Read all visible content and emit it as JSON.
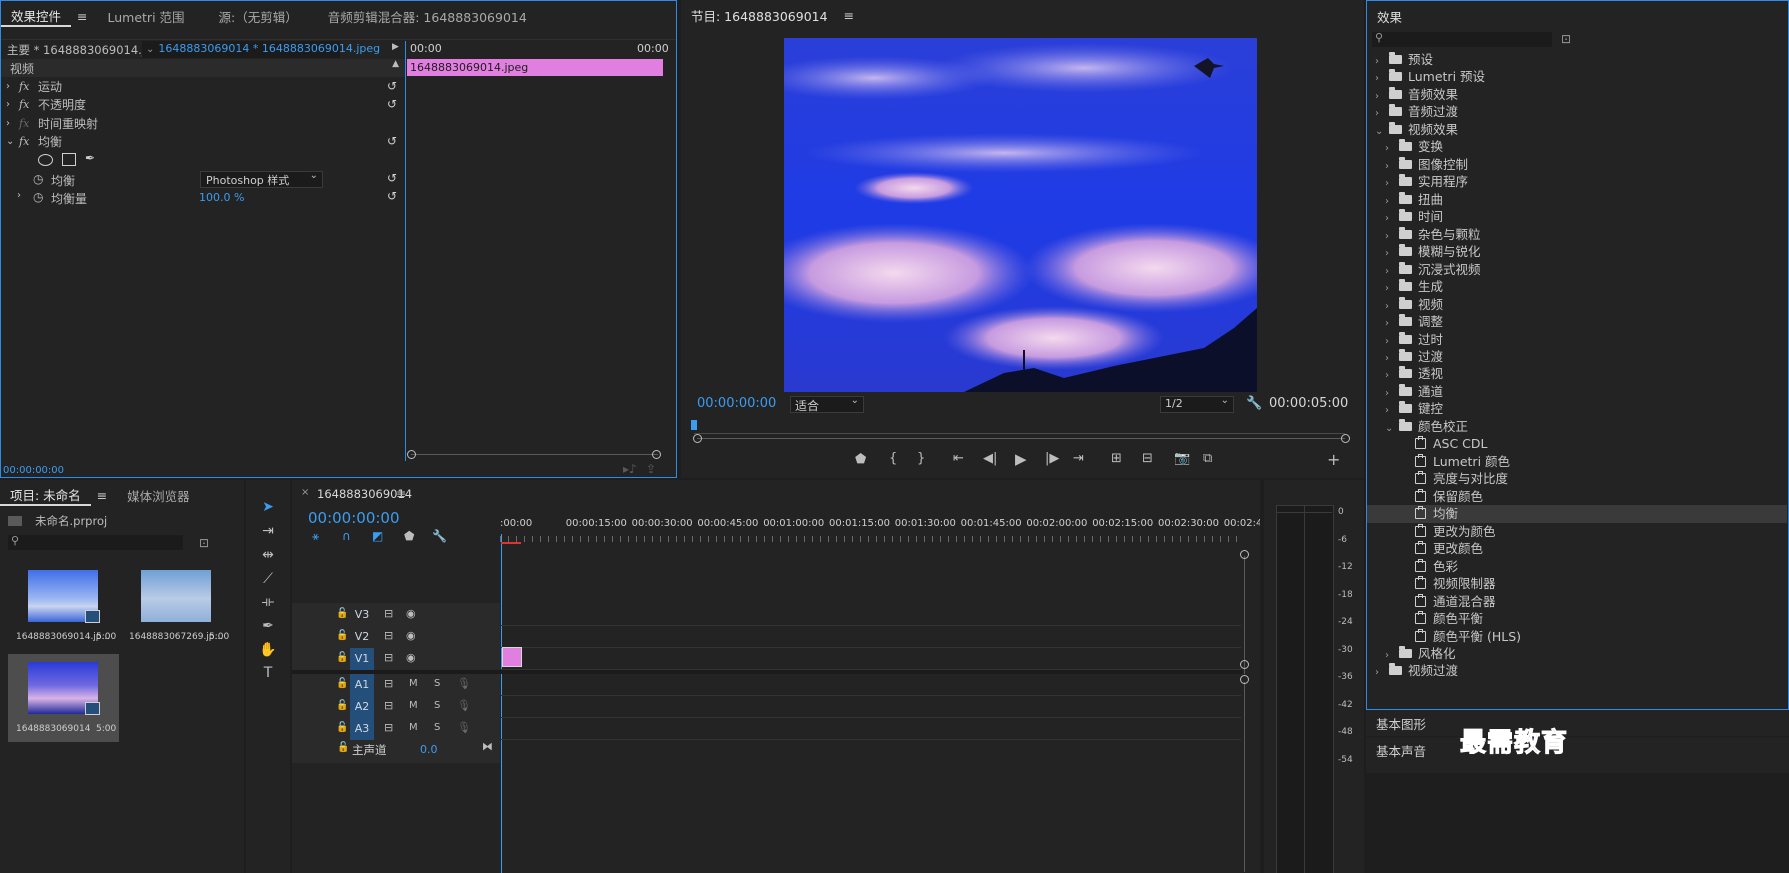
{
  "effect_controls": {
    "tabs": [
      "效果控件",
      "Lumetri 范围",
      "源:（无剪辑）",
      "音频剪辑混合器: 1648883069014"
    ],
    "master_label": "主要 * 1648883069014.jpeg",
    "clip_selector": "1648883069014 * 1648883069014.jpeg",
    "time_start": "00:00",
    "time_end": "00:00",
    "clip_name": "1648883069014.jpeg",
    "section_video": "视频",
    "effects": [
      {
        "fx": "fx",
        "name": "运动"
      },
      {
        "fx": "fx",
        "name": "不透明度"
      },
      {
        "fx": "fx",
        "name": "时间重映射"
      },
      {
        "fx": "fx",
        "name": "均衡"
      }
    ],
    "param_eq_name": "均衡",
    "param_eq_value": "Photoshop 样式",
    "param_amount_name": "均衡量",
    "param_amount_value": "100.0 %",
    "timecode": "00:00:00:00"
  },
  "program": {
    "title": "节目: 1648883069014",
    "timecode": "00:00:00:00",
    "fit": "适合",
    "resolution": "1/2",
    "duration": "00:00:05:00"
  },
  "effects_panel": {
    "title": "效果",
    "search_placeholder": "",
    "tree": [
      {
        "level": 0,
        "type": "folder",
        "label": "预设",
        "open": false
      },
      {
        "level": 0,
        "type": "folder",
        "label": "Lumetri 预设",
        "open": false
      },
      {
        "level": 0,
        "type": "folder",
        "label": "音频效果",
        "open": false
      },
      {
        "level": 0,
        "type": "folder",
        "label": "音频过渡",
        "open": false
      },
      {
        "level": 0,
        "type": "folder",
        "label": "视频效果",
        "open": true
      },
      {
        "level": 1,
        "type": "folder",
        "label": "变换",
        "open": false
      },
      {
        "level": 1,
        "type": "folder",
        "label": "图像控制",
        "open": false
      },
      {
        "level": 1,
        "type": "folder",
        "label": "实用程序",
        "open": false
      },
      {
        "level": 1,
        "type": "folder",
        "label": "扭曲",
        "open": false
      },
      {
        "level": 1,
        "type": "folder",
        "label": "时间",
        "open": false
      },
      {
        "level": 1,
        "type": "folder",
        "label": "杂色与颗粒",
        "open": false
      },
      {
        "level": 1,
        "type": "folder",
        "label": "模糊与锐化",
        "open": false
      },
      {
        "level": 1,
        "type": "folder",
        "label": "沉浸式视频",
        "open": false
      },
      {
        "level": 1,
        "type": "folder",
        "label": "生成",
        "open": false
      },
      {
        "level": 1,
        "type": "folder",
        "label": "视频",
        "open": false
      },
      {
        "level": 1,
        "type": "folder",
        "label": "调整",
        "open": false
      },
      {
        "level": 1,
        "type": "folder",
        "label": "过时",
        "open": false
      },
      {
        "level": 1,
        "type": "folder",
        "label": "过渡",
        "open": false
      },
      {
        "level": 1,
        "type": "folder",
        "label": "透视",
        "open": false
      },
      {
        "level": 1,
        "type": "folder",
        "label": "通道",
        "open": false
      },
      {
        "level": 1,
        "type": "folder",
        "label": "键控",
        "open": false
      },
      {
        "level": 1,
        "type": "folder",
        "label": "颜色校正",
        "open": true
      },
      {
        "level": 2,
        "type": "fx",
        "label": "ASC CDL"
      },
      {
        "level": 2,
        "type": "fx",
        "label": "Lumetri 颜色"
      },
      {
        "level": 2,
        "type": "fx",
        "label": "亮度与对比度"
      },
      {
        "level": 2,
        "type": "fx",
        "label": "保留颜色"
      },
      {
        "level": 2,
        "type": "fx",
        "label": "均衡",
        "selected": true
      },
      {
        "level": 2,
        "type": "fx",
        "label": "更改为颜色"
      },
      {
        "level": 2,
        "type": "fx",
        "label": "更改颜色"
      },
      {
        "level": 2,
        "type": "fx",
        "label": "色彩"
      },
      {
        "level": 2,
        "type": "fx",
        "label": "视频限制器"
      },
      {
        "level": 2,
        "type": "fx",
        "label": "通道混合器"
      },
      {
        "level": 2,
        "type": "fx",
        "label": "颜色平衡"
      },
      {
        "level": 2,
        "type": "fx",
        "label": "颜色平衡 (HLS)"
      },
      {
        "level": 1,
        "type": "folder",
        "label": "风格化",
        "open": false
      },
      {
        "level": 0,
        "type": "folder",
        "label": "视频过渡",
        "open": false
      }
    ],
    "basic_graphics": "基本图形",
    "basic_sound": "基本声音",
    "watermark": "最需教育"
  },
  "project": {
    "tabs": [
      "项目: 未命名",
      "媒体浏览器"
    ],
    "project_file": "未命名.prproj",
    "items": [
      {
        "name": "1648883069014.jp...",
        "duration": "5:00"
      },
      {
        "name": "1648883067269.jp...",
        "duration": "5:00"
      },
      {
        "name": "1648883069014",
        "duration": "5:00"
      }
    ]
  },
  "timeline": {
    "sequence_name": "1648883069014",
    "timecode": "00:00:00:00",
    "ruler": [
      ":00:00",
      "00:00:15:00",
      "00:00:30:00",
      "00:00:45:00",
      "00:01:00:00",
      "00:01:15:00",
      "00:01:30:00",
      "00:01:45:00",
      "00:02:00:00",
      "00:02:15:00",
      "00:02:30:00",
      "00:02:45:"
    ],
    "video_tracks": [
      "V3",
      "V2",
      "V1"
    ],
    "audio_tracks": [
      "A1",
      "A2",
      "A3"
    ],
    "m_label": "M",
    "s_label": "S",
    "master": "主声道",
    "master_value": "0.0"
  },
  "meter": {
    "ticks": [
      "0",
      "-6",
      "-12",
      "-18",
      "-24",
      "-30",
      "-36",
      "-42",
      "-48",
      "-54"
    ]
  },
  "colors": {
    "accent": "#2d8ceb",
    "clip": "#e07fe0",
    "track_active": "#234f7a"
  }
}
